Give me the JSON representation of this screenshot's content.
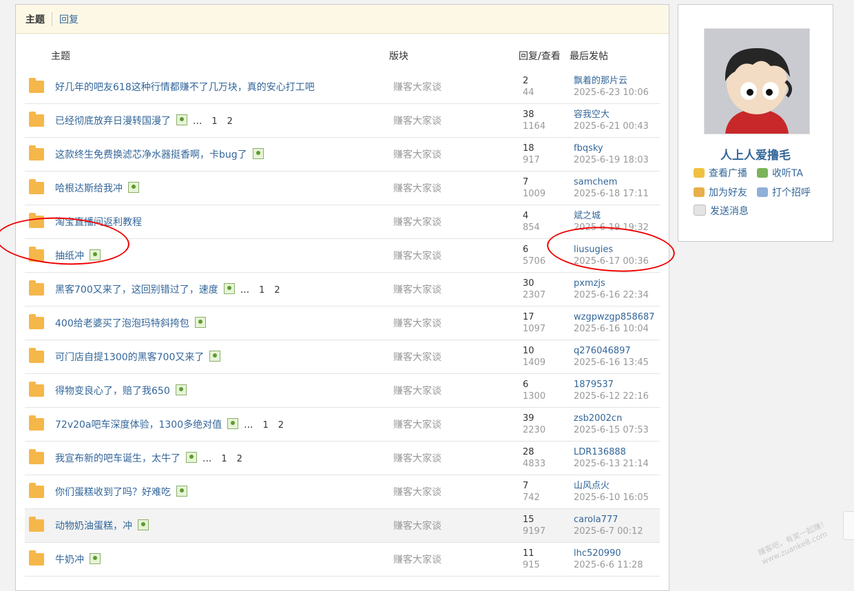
{
  "tabs": {
    "topics": "主题",
    "replies": "回复"
  },
  "columns": {
    "title": "主题",
    "forum": "版块",
    "stats": "回复/查看",
    "last": "最后发帖"
  },
  "rows": [
    {
      "title": "好几年的吧友618这种行情都赚不了几万块，真的安心打工吧",
      "forum": "赚客大家谈",
      "replies": "2",
      "views": "44",
      "user": "飘着的那片云",
      "time": "2025-6-23 10:06"
    },
    {
      "title": "已经彻底放弃日漫转国漫了",
      "forum": "赚客大家谈",
      "replies": "38",
      "views": "1164",
      "user": "容我空大",
      "time": "2025-6-21 00:43",
      "dots": "...",
      "pages": [
        "1",
        "2"
      ]
    },
    {
      "title": "这款终生免费换滤芯净水器挺香啊，卡bug了",
      "forum": "赚客大家谈",
      "replies": "18",
      "views": "917",
      "user": "fbqsky",
      "time": "2025-6-19 18:03"
    },
    {
      "title": "哈根达斯给我冲",
      "forum": "赚客大家谈",
      "replies": "7",
      "views": "1009",
      "user": "samchem",
      "time": "2025-6-18 17:11"
    },
    {
      "title": "淘宝直播间返利教程",
      "forum": "赚客大家谈",
      "replies": "4",
      "views": "854",
      "user": "斌之城",
      "time": "2025-6-19 19:32"
    },
    {
      "title": "抽纸冲",
      "forum": "赚客大家谈",
      "replies": "6",
      "views": "5706",
      "user": "liusugies",
      "time": "2025-6-17 00:36"
    },
    {
      "title": "黑客700又来了，这回别错过了，速度",
      "forum": "赚客大家谈",
      "replies": "30",
      "views": "2307",
      "user": "pxmzjs",
      "time": "2025-6-16 22:34",
      "dots": "...",
      "pages": [
        "1",
        "2"
      ]
    },
    {
      "title": "400给老婆买了泡泡玛特斜挎包",
      "forum": "赚客大家谈",
      "replies": "17",
      "views": "1097",
      "user": "wzgpwzgp858687",
      "time": "2025-6-16 10:04"
    },
    {
      "title": "可门店自提1300的黑客700又来了",
      "forum": "赚客大家谈",
      "replies": "10",
      "views": "1409",
      "user": "q276046897",
      "time": "2025-6-16 13:45"
    },
    {
      "title": "得物变良心了，赔了我650",
      "forum": "赚客大家谈",
      "replies": "6",
      "views": "1300",
      "user": "1879537",
      "time": "2025-6-12 22:16"
    },
    {
      "title": "72v20a吧车深度体验，1300多绝对值",
      "forum": "赚客大家谈",
      "replies": "39",
      "views": "2230",
      "user": "zsb2002cn",
      "time": "2025-6-15 07:53",
      "dots": "...",
      "pages": [
        "1",
        "2"
      ]
    },
    {
      "title": "我宣布新的吧车诞生，太牛了",
      "forum": "赚客大家谈",
      "replies": "28",
      "views": "4833",
      "user": "LDR136888",
      "time": "2025-6-13 21:14",
      "dots": "...",
      "pages": [
        "1",
        "2"
      ]
    },
    {
      "title": "你们蛋糕收到了吗？好难吃",
      "forum": "赚客大家谈",
      "replies": "7",
      "views": "742",
      "user": "山风点火",
      "time": "2025-6-10 16:05"
    },
    {
      "title": "动物奶油蛋糕，冲",
      "forum": "赚客大家谈",
      "replies": "15",
      "views": "9197",
      "user": "carola777",
      "time": "2025-6-7 00:12"
    },
    {
      "title": "牛奶冲",
      "forum": "赚客大家谈",
      "replies": "11",
      "views": "915",
      "user": "lhc520990",
      "time": "2025-6-6 11:28"
    }
  ],
  "profile": {
    "name": "人上人爱撸毛",
    "actions": {
      "broadcast": "查看广播",
      "follow": "收听TA",
      "friend": "加为好友",
      "greet": "打个招呼",
      "message": "发送消息"
    }
  },
  "watermark": "赚客吧，有奖一起赚！ www.zuanke8.com"
}
